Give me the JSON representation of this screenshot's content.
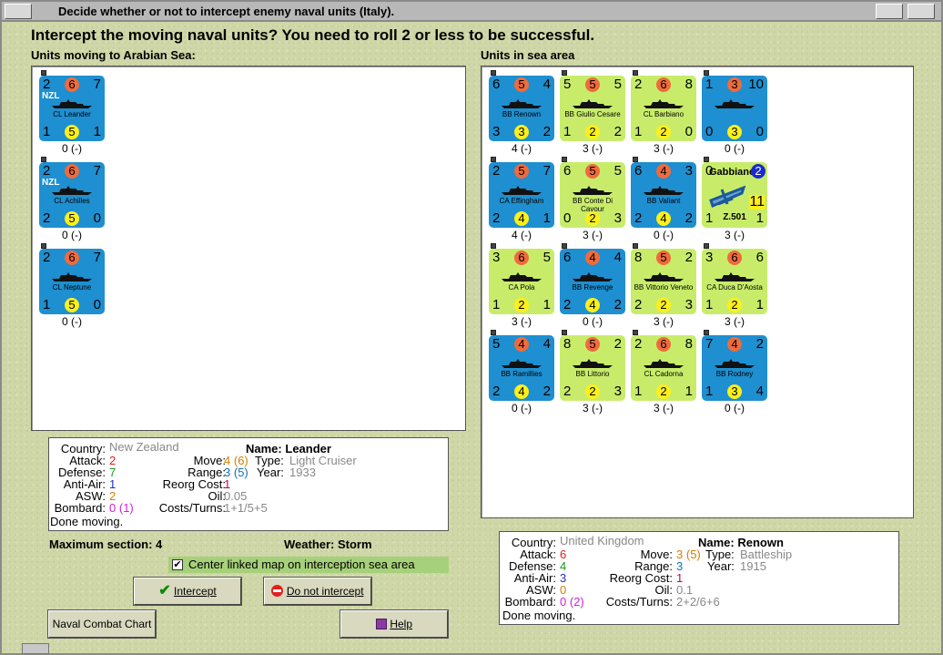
{
  "window": {
    "title": "Decide whether or not to intercept enemy naval units (Italy)."
  },
  "heading": "Intercept the moving naval units?  You need to roll 2 or less to be successful.",
  "moving_label": "Units moving to Arabian Sea:",
  "sea_label": "Units in sea area",
  "moving_units": [
    {
      "tl": "2",
      "att": "6",
      "tr": "7",
      "bl": "1",
      "aa": "5",
      "br": "1",
      "name": "CL Leander",
      "nzl": "NZL",
      "count": "0 (-)"
    },
    {
      "tl": "2",
      "att": "6",
      "tr": "7",
      "bl": "2",
      "aa": "5",
      "br": "0",
      "name": "CL Achilles",
      "nzl": "NZL",
      "count": "0 (-)"
    },
    {
      "tl": "2",
      "att": "6",
      "tr": "7",
      "bl": "1",
      "aa": "5",
      "br": "0",
      "name": "CL Neptune",
      "nzl": "",
      "count": "0 (-)"
    }
  ],
  "sea_units": [
    {
      "tl": "6",
      "att": "5",
      "tr": "4",
      "bl": "3",
      "aa": "3",
      "br": "2",
      "name": "BB Renown",
      "count": "4 (-)",
      "color": "blue"
    },
    {
      "tl": "5",
      "att": "5",
      "tr": "5",
      "bl": "1",
      "aa": "2",
      "br": "2",
      "name": "BB Giulio Cesare",
      "count": "3 (-)",
      "color": "green"
    },
    {
      "tl": "2",
      "att": "6",
      "tr": "8",
      "bl": "1",
      "aa": "2",
      "br": "0",
      "name": "CL Barbiano",
      "count": "3 (-)",
      "color": "green"
    },
    {
      "tl": "1",
      "att": "3",
      "tr": "10",
      "bl": "0",
      "aa": "3",
      "br": "0",
      "name": "",
      "count": "0 (-)",
      "color": "blue"
    },
    {
      "tl": "2",
      "att": "5",
      "tr": "7",
      "bl": "2",
      "aa": "4",
      "br": "1",
      "name": "CA Effingham",
      "count": "4 (-)",
      "color": "blue"
    },
    {
      "tl": "6",
      "att": "5",
      "tr": "5",
      "bl": "0",
      "aa": "2",
      "br": "3",
      "name": "BB Conte Di Cavour",
      "count": "3 (-)",
      "color": "green"
    },
    {
      "tl": "6",
      "att": "4",
      "tr": "3",
      "bl": "2",
      "aa": "4",
      "br": "2",
      "name": "BB Valiant",
      "count": "0 (-)",
      "color": "blue"
    },
    {
      "tl": "0",
      "att": "Gabbiano",
      "tr": "2",
      "bl": "1",
      "aa": "11",
      "br": "1",
      "name": "Z.501",
      "count": "3 (-)",
      "color": "green"
    },
    {
      "tl": "3",
      "att": "6",
      "tr": "5",
      "bl": "1",
      "aa": "2",
      "br": "1",
      "name": "CA Pola",
      "count": "3 (-)",
      "color": "green"
    },
    {
      "tl": "6",
      "att": "4",
      "tr": "4",
      "bl": "2",
      "aa": "4",
      "br": "2",
      "name": "BB Revenge",
      "count": "0 (-)",
      "color": "blue"
    },
    {
      "tl": "8",
      "att": "5",
      "tr": "2",
      "bl": "2",
      "aa": "2",
      "br": "3",
      "name": "BB Vittorio Veneto",
      "count": "3 (-)",
      "color": "green"
    },
    {
      "tl": "3",
      "att": "6",
      "tr": "6",
      "bl": "1",
      "aa": "2",
      "br": "1",
      "name": "CA Duca D'Aosta",
      "count": "3 (-)",
      "color": "green"
    },
    {
      "tl": "5",
      "att": "4",
      "tr": "4",
      "bl": "2",
      "aa": "4",
      "br": "2",
      "name": "BB Ramillies",
      "count": "0 (-)",
      "color": "blue"
    },
    {
      "tl": "8",
      "att": "5",
      "tr": "2",
      "bl": "2",
      "aa": "2",
      "br": "3",
      "name": "BB Littorio",
      "count": "3 (-)",
      "color": "green"
    },
    {
      "tl": "2",
      "att": "6",
      "tr": "8",
      "bl": "1",
      "aa": "2",
      "br": "1",
      "name": "CL Cadorna",
      "count": "3 (-)",
      "color": "green"
    },
    {
      "tl": "7",
      "att": "4",
      "tr": "2",
      "bl": "1",
      "aa": "3",
      "br": "4",
      "name": "BB Rodney",
      "count": "0 (-)",
      "color": "blue"
    }
  ],
  "left_info": {
    "country_label": "Country:",
    "country": "New Zealand",
    "attack_label": "Attack:",
    "attack": "2",
    "defense_label": "Defense:",
    "defense": "7",
    "antiair_label": "Anti-Air:",
    "antiair": "1",
    "asw_label": "ASW:",
    "asw": "2",
    "bombard_label": "Bombard:",
    "bombard": "0",
    "bombard2": "(1)",
    "name_label": "Name:",
    "name": "Leander",
    "move_label": "Move:",
    "move": "4",
    "move2": "(6)",
    "type_label": "Type:",
    "type": "Light Cruiser",
    "range_label": "Range:",
    "range": "3",
    "range2": "(5)",
    "year_label": "Year:",
    "year": "1933",
    "reorg_label": "Reorg Cost:",
    "reorg": "1",
    "oil_label": "Oil:",
    "oil": "0.05",
    "costs_label": "Costs/Turns:",
    "costs": "1+1/5+5",
    "status": "Done moving."
  },
  "right_info": {
    "country_label": "Country:",
    "country": "United Kingdom",
    "attack_label": "Attack:",
    "attack": "6",
    "defense_label": "Defense:",
    "defense": "4",
    "antiair_label": "Anti-Air:",
    "antiair": "3",
    "asw_label": "ASW:",
    "asw": "0",
    "bombard_label": "Bombard:",
    "bombard": "0",
    "bombard2": "(2)",
    "name_label": "Name:",
    "name": "Renown",
    "move_label": "Move:",
    "move": "3",
    "move2": "(5)",
    "type_label": "Type:",
    "type": "Battleship",
    "range_label": "Range:",
    "range": "3",
    "year_label": "Year:",
    "year": "1915",
    "reorg_label": "Reorg Cost:",
    "reorg": "1",
    "oil_label": "Oil:",
    "oil": "0.1",
    "costs_label": "Costs/Turns:",
    "costs": "2+2/6+6",
    "status": "Done moving."
  },
  "max_section": "Maximum section: 4",
  "weather": "Weather:  Storm",
  "center_checkbox": {
    "label": "Center linked map on interception sea area",
    "checked": "✔"
  },
  "buttons": {
    "intercept": "Intercept",
    "no_intercept": "Do not intercept",
    "combat_chart": "Naval Combat Chart",
    "help": "Help"
  },
  "colors": {
    "blue": "#1e8fd0",
    "green": "#c8ec6a",
    "attack_red": "#ef6a3c",
    "aa_yellow": "#ffef1a"
  }
}
